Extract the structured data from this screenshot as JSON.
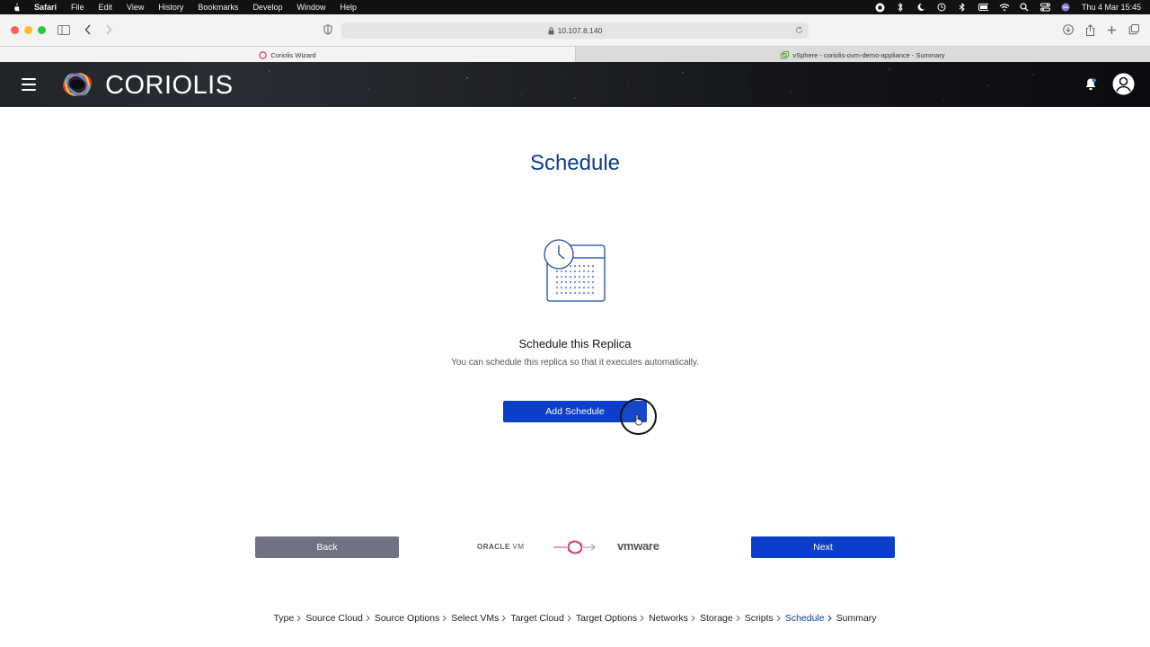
{
  "menubar": {
    "app": "Safari",
    "items": [
      "File",
      "Edit",
      "View",
      "History",
      "Bookmarks",
      "Develop",
      "Window",
      "Help"
    ],
    "clock": "Thu 4 Mar  15:45"
  },
  "browser": {
    "url": "10.107.8.140",
    "tabs": [
      {
        "label": "Coriolis Wizard",
        "active": true
      },
      {
        "label": "vSphere - coriolis-ovm-demo-appliance - Summary",
        "active": false
      }
    ]
  },
  "app": {
    "brand": "CORIOLIS"
  },
  "main": {
    "title": "Schedule",
    "subheading": "Schedule this Replica",
    "description": "You can schedule this replica so that it executes automatically.",
    "add_schedule_label": "Add Schedule",
    "back_label": "Back",
    "next_label": "Next",
    "source_logo_text": "ORACLE",
    "source_logo_suffix": "VM",
    "target_logo_text": "vmware"
  },
  "steps": [
    {
      "label": "Type"
    },
    {
      "label": "Source Cloud"
    },
    {
      "label": "Source Options"
    },
    {
      "label": "Select VMs"
    },
    {
      "label": "Target Cloud"
    },
    {
      "label": "Target Options"
    },
    {
      "label": "Networks"
    },
    {
      "label": "Storage"
    },
    {
      "label": "Scripts"
    },
    {
      "label": "Schedule",
      "current": true
    },
    {
      "label": "Summary"
    }
  ],
  "colors": {
    "primary": "#0b3fc9",
    "title": "#0b3d91",
    "back_button": "#6f7280"
  }
}
